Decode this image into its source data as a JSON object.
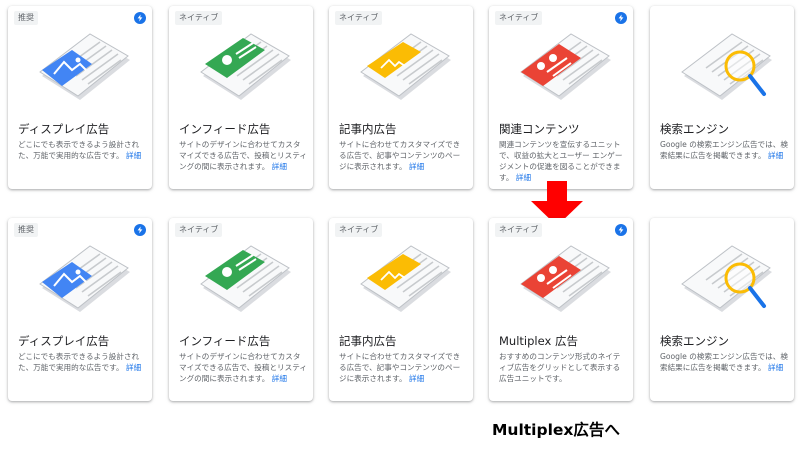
{
  "row_top": [
    {
      "tag": "推奨",
      "title": "ディスプレイ広告",
      "desc": "どこにでも表示できるよう設計された、万能で実用的な広告です。",
      "more": "詳細",
      "accent": "#4285f4",
      "icon": "display-ad-illustration"
    },
    {
      "tag": "ネイティブ",
      "title": "インフィード広告",
      "desc": "サイトのデザインに合わせてカスタマイズできる広告で、投稿とリスティングの間に表示されます。",
      "more": "詳細",
      "accent": "#34a853",
      "icon": "in-feed-ad-illustration"
    },
    {
      "tag": "ネイティブ",
      "title": "記事内広告",
      "desc": "サイトに合わせてカスタマイズできる広告で、記事やコンテンツのページに表示されます。",
      "more": "詳細",
      "accent": "#fbbc04",
      "icon": "in-article-ad-illustration"
    },
    {
      "tag": "ネイティブ",
      "title": "関連コンテンツ",
      "desc": "関連コンテンツを宣伝するユニットで、収益の拡大とユーザー エンゲージメントの促進を図ることができます。",
      "more": "詳細",
      "accent": "#ea4335",
      "icon": "matched-content-illustration"
    },
    {
      "tag": "",
      "title": "検索エンジン",
      "desc": "Google の検索エンジン広告では、検索結果に広告を掲載できます。",
      "more": "詳細",
      "accent": "#fbbc04",
      "icon": "search-engine-illustration"
    }
  ],
  "row_bottom": [
    {
      "tag": "推奨",
      "title": "ディスプレイ広告",
      "desc": "どこにでも表示できるよう設計された、万能で実用的な広告です。",
      "more": "詳細",
      "accent": "#4285f4",
      "icon": "display-ad-illustration"
    },
    {
      "tag": "ネイティブ",
      "title": "インフィード広告",
      "desc": "サイトのデザインに合わせてカスタマイズできる広告で、投稿とリスティングの間に表示されます。",
      "more": "詳細",
      "accent": "#34a853",
      "icon": "in-feed-ad-illustration"
    },
    {
      "tag": "ネイティブ",
      "title": "記事内広告",
      "desc": "サイトに合わせてカスタマイズできる広告で、記事やコンテンツのページに表示されます。",
      "more": "詳細",
      "accent": "#fbbc04",
      "icon": "in-article-ad-illustration"
    },
    {
      "tag": "ネイティブ",
      "title": "Multiplex 広告",
      "desc": "おすすめのコンテンツ形式のネイティブ広告をグリッドとして表示する広告ユニットです。",
      "more": "",
      "accent": "#ea4335",
      "icon": "multiplex-ad-illustration"
    },
    {
      "tag": "",
      "title": "検索エンジン",
      "desc": "Google の検索エンジン広告では、検索結果に広告を掲載できます。",
      "more": "詳細",
      "accent": "#fbbc04",
      "icon": "search-engine-illustration"
    }
  ],
  "caption": "Multiplex広告へ",
  "colors": {
    "link": "#1a73e8",
    "arrow": "#ff0000",
    "bolt": "#1a73e8"
  }
}
